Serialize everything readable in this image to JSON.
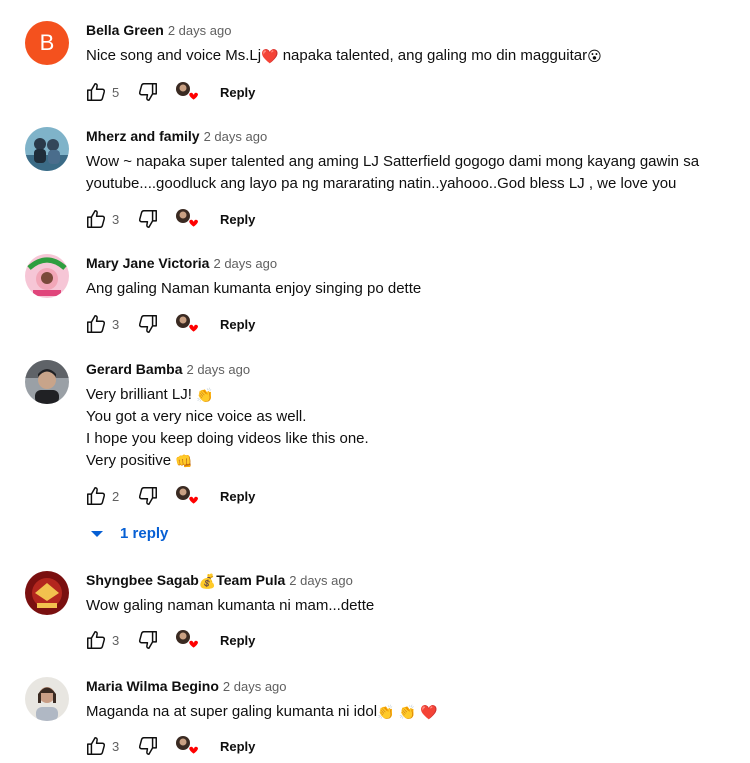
{
  "colors": {
    "link": "#065fd4",
    "meta": "#606060",
    "heart": "#ff0000",
    "avatar_b": "#f4511e"
  },
  "icons": {
    "like": "thumb-up-icon",
    "dislike": "thumb-down-icon",
    "creator_heart": "creator-heart-icon",
    "replies": "chevron-down-icon"
  },
  "reply_label": "Reply",
  "comments": [
    {
      "author": "Bella Green",
      "time": "2 days ago",
      "avatar_letter": "B",
      "lines": [
        "Nice song and voice Ms.Lj",
        "❤️",
        " napaka talented, ang galing mo din magguitar",
        "😮"
      ],
      "likes": "5"
    },
    {
      "author": "Mherz and family",
      "time": "2 days ago",
      "lines": [
        "Wow ~ napaka super talented ang aming LJ Satterfield gogogo dami mong kayang gawin sa",
        "youtube....goodluck  ang layo pa ng mararating natin..yahooo..God bless LJ , we love you"
      ],
      "likes": "3"
    },
    {
      "author": "Mary Jane Victoria",
      "time": "2 days ago",
      "lines": [
        "Ang galing Naman kumanta enjoy singing po dette"
      ],
      "likes": "3"
    },
    {
      "author": "Gerard Bamba",
      "time": "2 days ago",
      "lines": [
        "Very brilliant LJ! ",
        "👏",
        "You got a very nice voice as well.",
        "I hope you keep doing videos like this one.",
        "Very positive ",
        "👊"
      ],
      "likes": "2",
      "replies_label": "1 reply"
    },
    {
      "author_a": "Shyngbee Sagab",
      "author_emoji": "💰",
      "author_b": "Team Pula",
      "time": "2 days ago",
      "lines": [
        "Wow galing naman kumanta ni mam...dette"
      ],
      "likes": "3"
    },
    {
      "author": "Maria Wilma Begino",
      "time": "2 days ago",
      "lines": [
        "Maganda na at super galing kumanta ni idol",
        "👏",
        "👏",
        "❤️"
      ],
      "likes": "3"
    }
  ]
}
